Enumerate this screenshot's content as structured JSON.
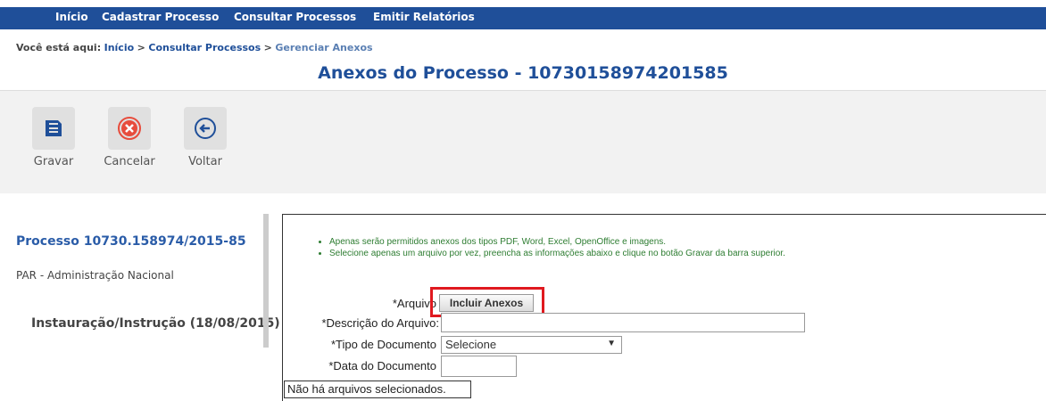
{
  "nav": {
    "items": [
      "Início",
      "Cadastrar Processo",
      "Consultar Processos",
      "Emitir Relatórios"
    ]
  },
  "breadcrumb": {
    "prefix": "Você está aqui:",
    "items": [
      "Início",
      "Consultar Processos",
      "Gerenciar Anexos"
    ],
    "separator": ">"
  },
  "page": {
    "title": "Anexos do Processo - 10730158974201585"
  },
  "toolbar": {
    "save_label": "Gravar",
    "cancel_label": "Cancelar",
    "back_label": "Voltar"
  },
  "sidebar": {
    "process_title": "Processo 10730.158974/2015-85",
    "subtitle": "PAR - Administração Nacional",
    "phase": "Instauração/Instrução (18/08/2015)"
  },
  "notes": [
    "Apenas serão permitidos anexos dos tipos PDF, Word, Excel, OpenOffice e imagens.",
    "Selecione apenas um arquivo por vez, preencha as informações abaixo e clique no botão Gravar da barra superior."
  ],
  "form": {
    "file_label": "*Arquivo",
    "upload_button": "Incluir Anexos",
    "description_label": "*Descrição do Arquivo:",
    "doc_type_label": "*Tipo de Documento",
    "doc_type_selected": "Selecione",
    "date_label": "*Data do Documento",
    "file_status": "Não há arquivos selecionados."
  },
  "colors": {
    "nav_bg": "#1f4f99",
    "title": "#1f4f99",
    "notes": "#2e7d32",
    "highlight": "#e0191f",
    "cancel_icon": "#e74c3c"
  }
}
